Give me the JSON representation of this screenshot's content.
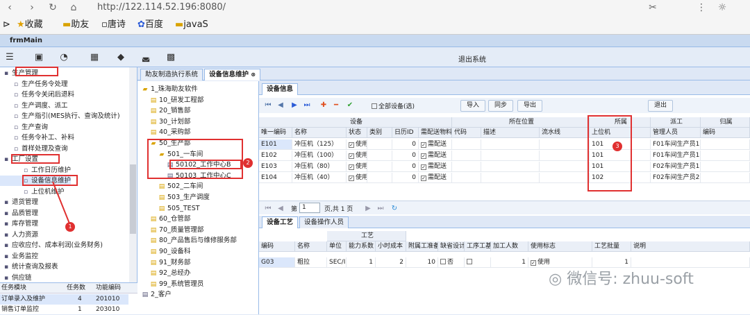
{
  "browser": {
    "url": "http://122.114.52.196:8080/",
    "bookmarks": [
      "收藏",
      "助友",
      "唐诗",
      "百度",
      "javaS"
    ]
  },
  "app": {
    "title": "frmMain",
    "logout": "退出系统"
  },
  "left_tree": [
    {
      "label": "生产管理",
      "indent": 0
    },
    {
      "label": "生产任务令处理",
      "indent": 1
    },
    {
      "label": "任务令关闭后退料",
      "indent": 1
    },
    {
      "label": "生产调度、派工",
      "indent": 1
    },
    {
      "label": "生产指引(MES执行、查询及统计)",
      "indent": 1
    },
    {
      "label": "生产查询",
      "indent": 1
    },
    {
      "label": "任务令补工、补料",
      "indent": 1
    },
    {
      "label": "首样处理及查询",
      "indent": 1
    },
    {
      "label": "工厂设置",
      "indent": 0
    },
    {
      "label": "工作日历维护",
      "indent": 2
    },
    {
      "label": "设备信息维护",
      "indent": 2
    },
    {
      "label": "上位机维护",
      "indent": 2
    },
    {
      "label": "退货管理",
      "indent": 0
    },
    {
      "label": "品质管理",
      "indent": 0
    },
    {
      "label": "库存管理",
      "indent": 0
    },
    {
      "label": "人力资源",
      "indent": 0
    },
    {
      "label": "应收应付、成本利润(业务财务)",
      "indent": 0
    },
    {
      "label": "业务监控",
      "indent": 0
    },
    {
      "label": "统计查询及报表",
      "indent": 0
    },
    {
      "label": "供应链",
      "indent": 0
    }
  ],
  "task_table": {
    "headers": [
      "任务模块",
      "任务数",
      "功能编码"
    ],
    "rows": [
      [
        "订单录入及维护",
        "4",
        "201010"
      ],
      [
        "销售订单监控",
        "1",
        "203010"
      ]
    ]
  },
  "tabs": [
    {
      "label": "助友制造执行系统"
    },
    {
      "label": "设备信息维护"
    }
  ],
  "org_tree": [
    {
      "label": "1_珠海助友软件",
      "indent": 0
    },
    {
      "label": "10_研发工程部",
      "indent": 1
    },
    {
      "label": "20_销售部",
      "indent": 1
    },
    {
      "label": "30_计划部",
      "indent": 1
    },
    {
      "label": "40_采购部",
      "indent": 1
    },
    {
      "label": "50_生产部",
      "indent": 1
    },
    {
      "label": "501_一车间",
      "indent": 2
    },
    {
      "label": "50102_工作中心B",
      "indent": 3
    },
    {
      "label": "50103_工作中心C",
      "indent": 3
    },
    {
      "label": "502_二车间",
      "indent": 2
    },
    {
      "label": "503_生产调度",
      "indent": 2
    },
    {
      "label": "505_TEST",
      "indent": 2
    },
    {
      "label": "60_仓管部",
      "indent": 1
    },
    {
      "label": "70_质量管理部",
      "indent": 1
    },
    {
      "label": "80_产品售后与维修服务部",
      "indent": 1
    },
    {
      "label": "90_设备科",
      "indent": 1
    },
    {
      "label": "91_财务部",
      "indent": 1
    },
    {
      "label": "92_总经办",
      "indent": 1
    },
    {
      "label": "99_系统管理员",
      "indent": 1
    },
    {
      "label": "2_客户",
      "indent": 0
    }
  ],
  "device": {
    "tab": "设备信息",
    "all_label": "全部设备(选)",
    "buttons": [
      "导入",
      "同步",
      "导出"
    ],
    "exit": "退出",
    "groups": [
      "设备",
      "所在位置",
      "所属",
      "派工",
      "归属"
    ],
    "headers": [
      "唯一编码",
      "名称",
      "状态",
      "类别",
      "日历ID",
      "需配送物料",
      "代码",
      "描述",
      "流水线",
      "上位机",
      "管理人员",
      "编码"
    ],
    "rows": [
      [
        "E101",
        "冲压机（125）",
        "使用",
        "",
        "0",
        "需配送",
        "",
        "",
        "",
        "101",
        "F01车间生产员1",
        ""
      ],
      [
        "E102",
        "冲压机（100）",
        "使用",
        "",
        "0",
        "需配送",
        "",
        "",
        "",
        "101",
        "F01车间生产员1",
        ""
      ],
      [
        "E103",
        "冲压机（80）",
        "使用",
        "",
        "0",
        "需配送",
        "",
        "",
        "",
        "101",
        "F02车间生产员1",
        ""
      ],
      [
        "E104",
        "冲压机（40）",
        "使用",
        "",
        "0",
        "需配送",
        "",
        "",
        "",
        "102",
        "F02车间生产员2",
        ""
      ]
    ],
    "pager": {
      "page_label": "第",
      "page": "1",
      "total": "页,共 1 页"
    }
  },
  "process": {
    "tabs": [
      "设备工艺",
      "设备操作人员"
    ],
    "group": "工艺",
    "headers": [
      "编码",
      "名称",
      "单位",
      "能力系数",
      "小时成本",
      "附属工准备",
      "缺省设计",
      "工序工基准设计",
      "加工人数",
      "使用标志",
      "工艺批量",
      "说明"
    ],
    "rows": [
      [
        "G03",
        "粗拉",
        "SEC/I",
        "1",
        "2",
        "10",
        "否",
        "",
        "1",
        "使用",
        "1",
        ""
      ]
    ]
  },
  "annotations": [
    "1",
    "2",
    "3"
  ],
  "watermark": "微信号: zhuu-soft"
}
